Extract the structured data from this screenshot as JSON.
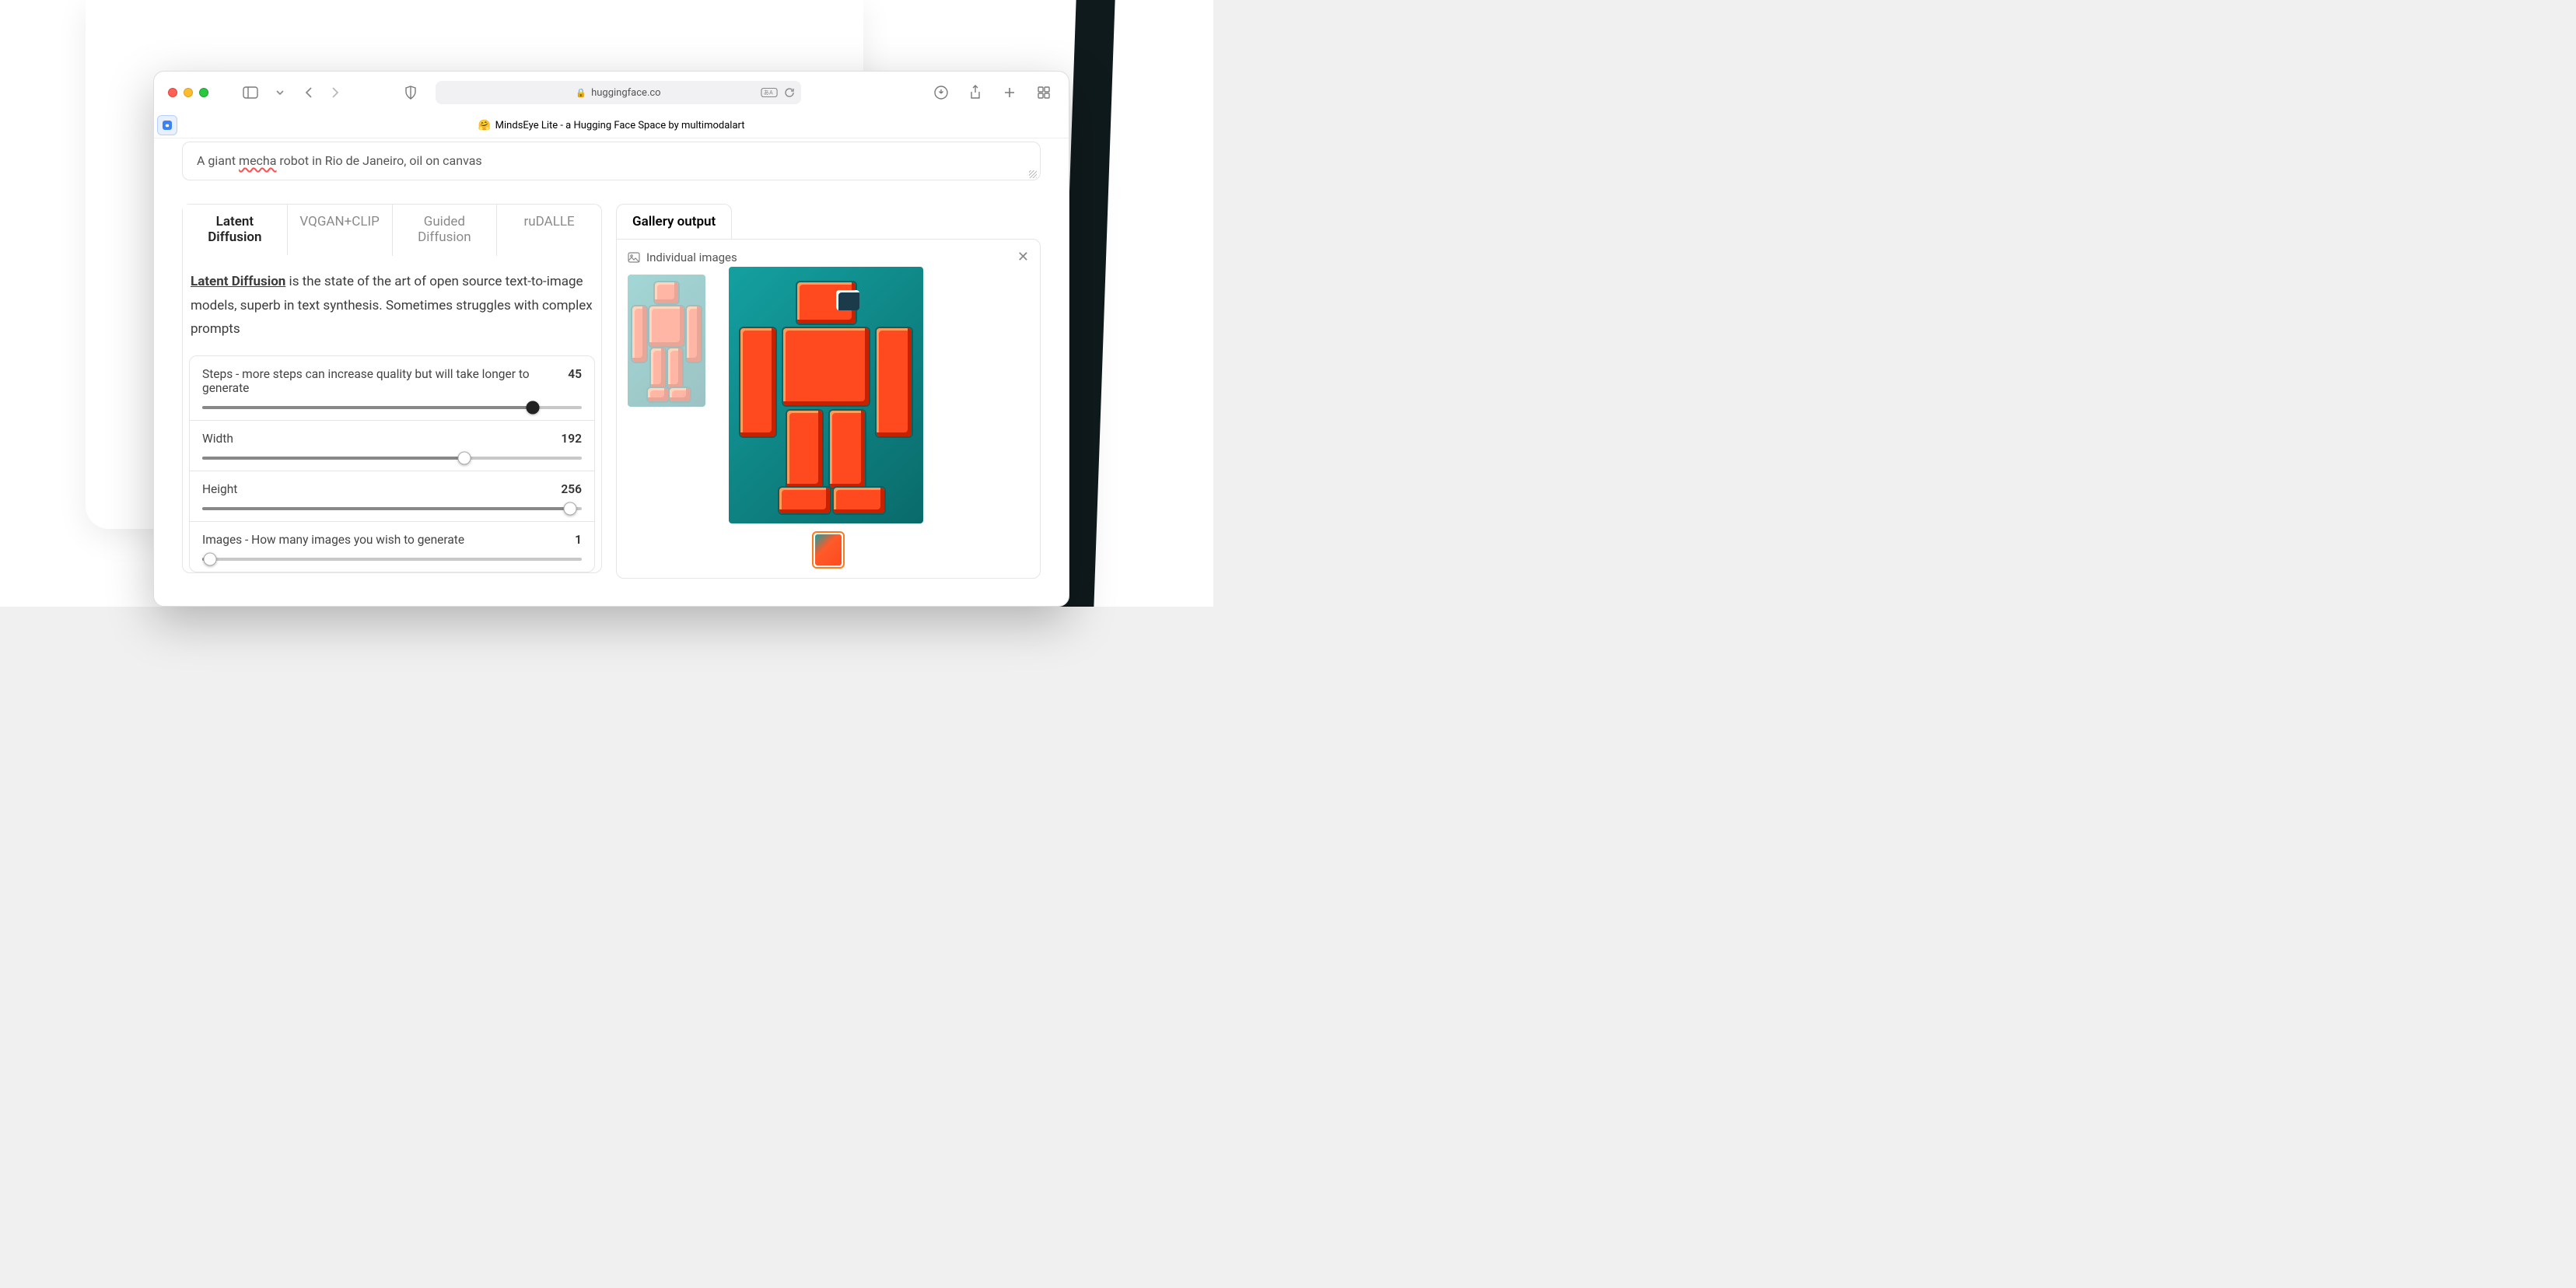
{
  "address_bar": {
    "host": "huggingface.co"
  },
  "tab": {
    "emoji": "🤗",
    "title": "MindsEye Lite - a Hugging Face Space by multimodalart"
  },
  "prompt": {
    "text_prefix": "A giant ",
    "spelled": "mecha",
    "text_suffix": " robot in Rio de Janeiro, oil on canvas"
  },
  "models": {
    "tabs": [
      {
        "label": "Latent Diffusion"
      },
      {
        "label": "VQGAN+CLIP"
      },
      {
        "label": "Guided Diffusion"
      },
      {
        "label": "ruDALLE"
      }
    ],
    "desc_link": "Latent Diffusion",
    "desc_rest": " is the state of the art of open source text-to-image models, superb in text synthesis. Sometimes struggles with complex prompts"
  },
  "sliders": {
    "steps": {
      "label": "Steps - more steps can increase quality but will take longer to generate",
      "value": "45",
      "pct": 87
    },
    "width": {
      "label": "Width",
      "value": "192",
      "pct": 69
    },
    "height": {
      "label": "Height",
      "value": "256",
      "pct": 97
    },
    "images": {
      "label": "Images - How many images you wish to generate",
      "value": "1",
      "pct": 2
    }
  },
  "gallery": {
    "title": "Gallery output",
    "individual": "Individual images"
  }
}
